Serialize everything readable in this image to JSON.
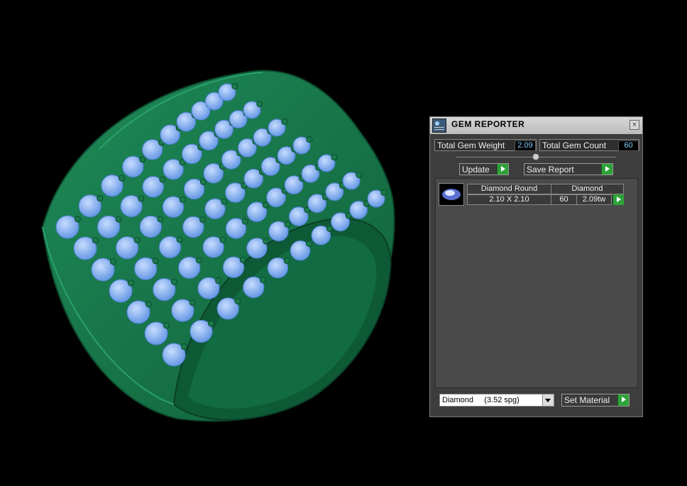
{
  "panel": {
    "title": "GEM REPORTER",
    "close_label": "×",
    "stats": {
      "total_weight_label": "Total Gem Weight",
      "total_weight_value": "2.09",
      "total_count_label": "Total Gem Count",
      "total_count_value": "60"
    },
    "buttons": {
      "update_label": "Update",
      "save_report_label": "Save Report",
      "set_material_label": "Set Material"
    },
    "gem_list": {
      "header_name": "Diamond Round",
      "header_material": "Diamond",
      "row": {
        "size": "2.10 X 2.10",
        "count": "60",
        "weight": "2.09tw"
      }
    },
    "material_select": {
      "value": "Diamond     (3.52 spg)"
    }
  },
  "colors": {
    "ring_green": "#1f7a50",
    "gem_blue": "#7ab0f0",
    "button_green": "#2fa33a"
  }
}
